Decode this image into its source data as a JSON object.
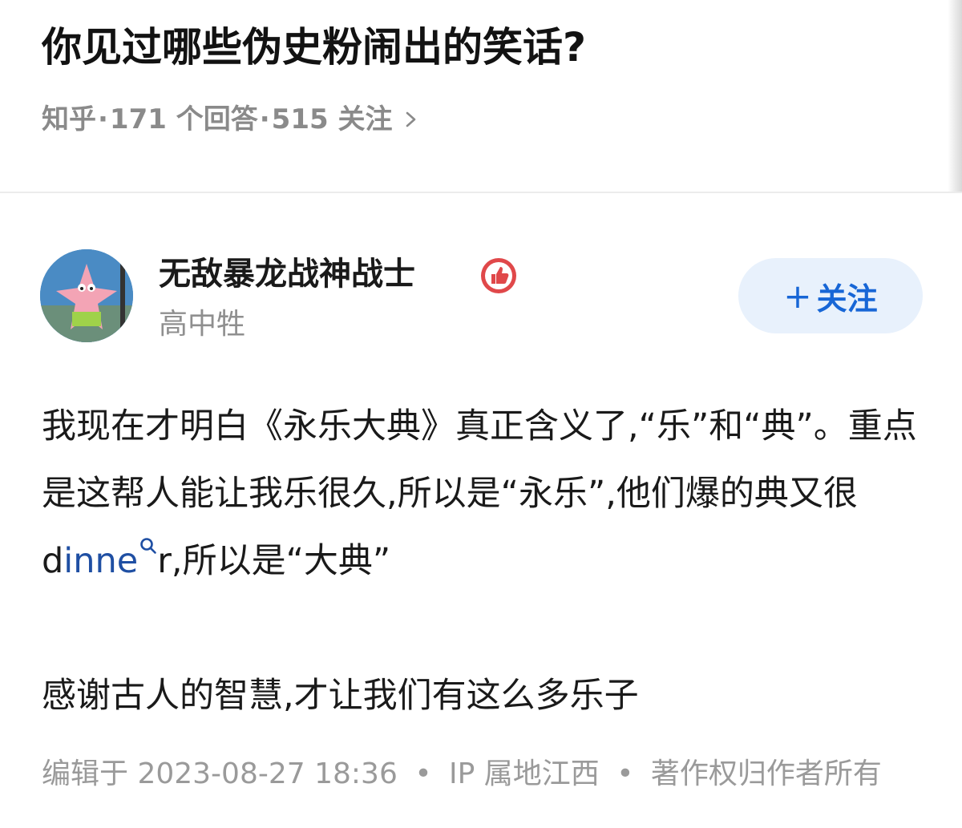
{
  "question": {
    "title": "你见过哪些伪史粉闹出的笑话?",
    "source": "知乎",
    "answers": "171 个回答",
    "followers": "515 关注"
  },
  "author": {
    "name": "无敌暴龙战神战士",
    "headline": "高中牲",
    "follow_label": "关注",
    "follow_icon": "plus-icon",
    "badge_icon": "thumbs-up-icon"
  },
  "answer": {
    "paragraph1_part1": "我现在才明白《永乐大典》真正含义了,“乐”和“典”。重点是这帮人能让我乐很久,所以是“永乐”,他们爆的典又很",
    "paragraph1_part2": "d",
    "keyword": "inne",
    "paragraph1_part3": "r,所以是“大典”",
    "paragraph2": "感谢古人的智慧,才让我们有这么多乐子"
  },
  "footer": {
    "edited": "编辑于 2023-08-27 18:36",
    "ip": "IP 属地江西",
    "copyright": "著作权归作者所有"
  },
  "colors": {
    "link_blue": "#1f4fa3",
    "follow_blue": "#1766d6",
    "follow_bg": "#e8f1fc",
    "meta_gray": "#8a8a8a",
    "badge_red": "#e0484a"
  }
}
